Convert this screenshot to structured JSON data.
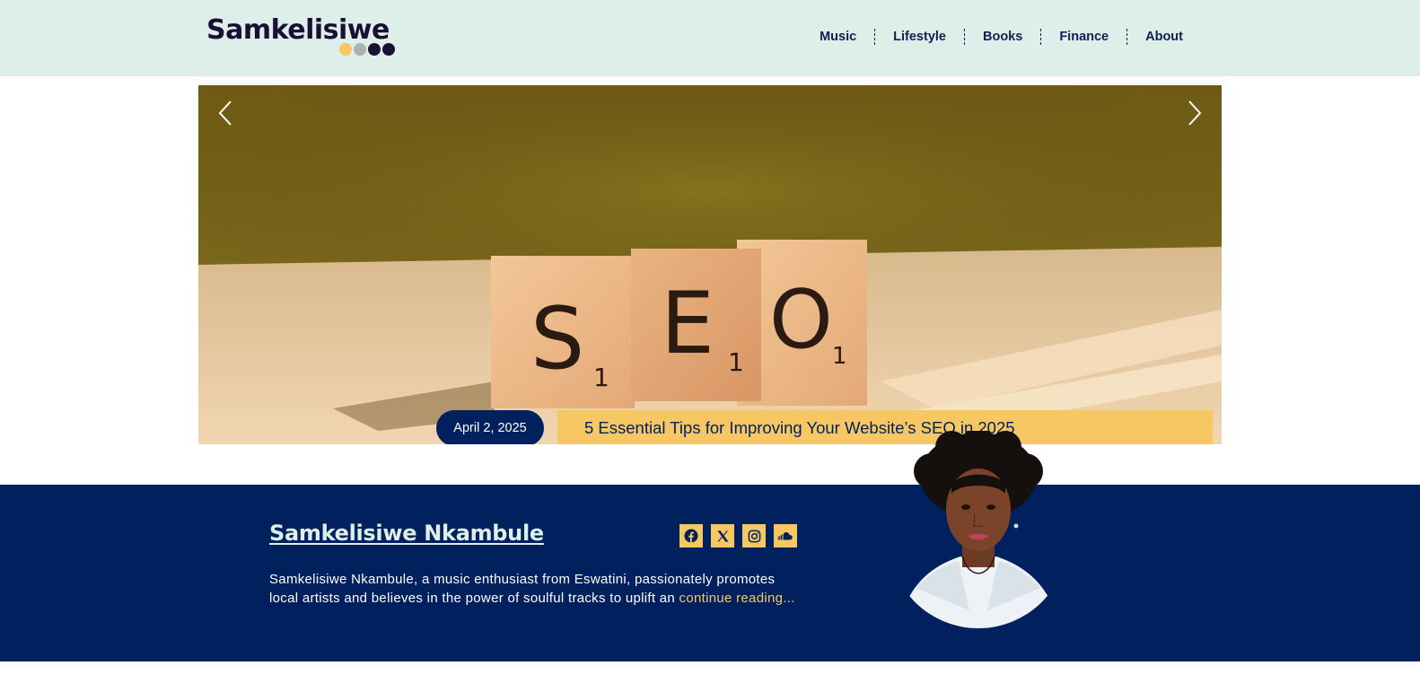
{
  "site": {
    "logo_text": "Samkelisiwe",
    "logo_dot_colors": [
      "#f6c763",
      "#a9b3b0",
      "#1a1033",
      "#1a1033"
    ]
  },
  "nav": {
    "items": [
      {
        "label": "Music"
      },
      {
        "label": "Lifestyle"
      },
      {
        "label": "Books"
      },
      {
        "label": "Finance"
      },
      {
        "label": "About"
      }
    ]
  },
  "hero": {
    "image": "seo-scrabble-tiles",
    "tiles": [
      "S",
      "E",
      "O"
    ],
    "date": "April 2, 2025",
    "title": "5 Essential Tips for Improving Your Website’s SEO in 2025"
  },
  "author": {
    "name": "Samkelisiwe Nkambule",
    "bio": "Samkelisiwe Nkambule, a music enthusiast from Eswatini, passionately promotes local artists and believes in the power of soulful tracks to uplift an ",
    "read_more": "continue reading...",
    "socials": [
      {
        "icon": "facebook-icon"
      },
      {
        "icon": "x-icon"
      },
      {
        "icon": "instagram-icon"
      },
      {
        "icon": "soundcloud-icon"
      }
    ]
  },
  "colors": {
    "header_bg": "#deeee9",
    "navy": "#00215e",
    "accent": "#f6c763"
  }
}
